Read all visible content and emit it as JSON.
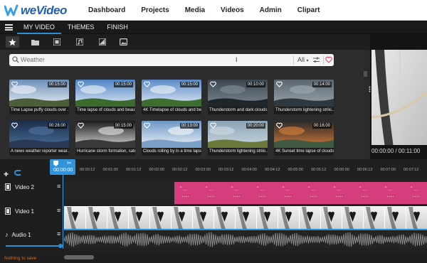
{
  "nav": {
    "logo_text": "weVideo",
    "links": [
      "Dashboard",
      "Projects",
      "Media",
      "Videos",
      "Admin",
      "Clipart"
    ]
  },
  "modes": {
    "tabs": [
      "MY VIDEO",
      "THEMES",
      "FINISH"
    ],
    "active": "MY VIDEO"
  },
  "toolbar": {
    "icons": [
      "star-icon",
      "folder-icon",
      "video-library-icon",
      "music-library-icon",
      "image-library-icon",
      "photos-icon"
    ]
  },
  "search": {
    "placeholder": "Weather",
    "filter_label": "All"
  },
  "library": {
    "items": [
      {
        "caption": "Time Lapse puffy clouds over ...",
        "duration": "00:15:00"
      },
      {
        "caption": "Time lapse of clouds and beaut...",
        "duration": "00:15:00"
      },
      {
        "caption": "4K Timelapse of clouds and bea...",
        "duration": "00:15:00"
      },
      {
        "caption": "Thunderstorm and dark clouds ...",
        "duration": "00:10:00"
      },
      {
        "caption": "Thunderstorm lightening striki...",
        "duration": "00:14:00"
      },
      {
        "caption": "A news weather reporter wear...",
        "duration": "00:28:00"
      },
      {
        "caption": "Hurricane storm formation, sate...",
        "duration": "00:15:00"
      },
      {
        "caption": "Clouds rolling by in a time lapse",
        "duration": "00:13:00"
      },
      {
        "caption": "Thunderstorm lightening striki...",
        "duration": "00:20:00"
      },
      {
        "caption": "4K Sunset time lapse of clouds...",
        "duration": "00:16:00"
      }
    ]
  },
  "preview": {
    "timecode": "00:00:00 / 00:11:00"
  },
  "timeline": {
    "playhead_time": "00:00:00",
    "ruler_ticks": [
      "00:00:12",
      "00:01:00",
      "00:01:12",
      "00:02:00",
      "00:02:12",
      "00:03:00",
      "00:03:12",
      "00:04:00",
      "00:04:12",
      "00:05:00",
      "00:05:12",
      "00:06:00",
      "00:06:12",
      "00:07:00",
      "00:07:12"
    ],
    "tracks": [
      {
        "label": "Video 2"
      },
      {
        "label": "Video 1"
      },
      {
        "label": "Audio 1"
      }
    ]
  },
  "status_text": "Nothing to save",
  "colors": {
    "accent": "#2b8fd6",
    "title_clip": "#d63d7c",
    "status": "#e26a1a"
  }
}
